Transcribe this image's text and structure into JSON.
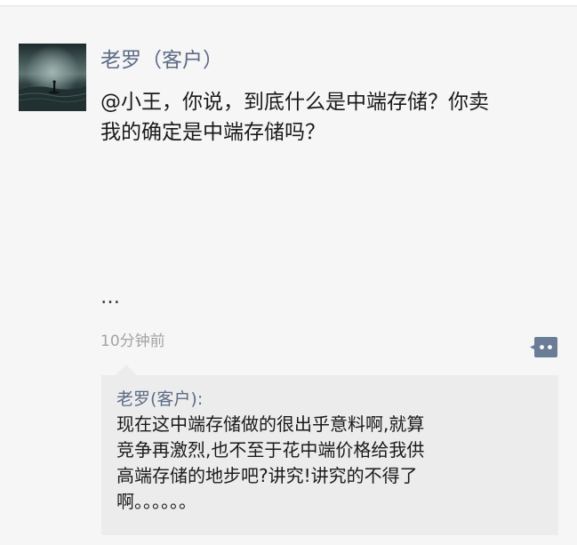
{
  "post": {
    "author": "老罗（客户）",
    "text_lines": [
      "@小王，你说，到底什么是中端存储？你卖",
      "我的确定是中端存储吗？"
    ],
    "ellipsis": "…",
    "timestamp": "10分钟前",
    "comment_icon": "comment-bubble-icon"
  },
  "comment": {
    "author": "老罗(客户):",
    "text_lines": [
      "现在这中端存储做的很出乎意料啊,就算",
      "竞争再激烈,也不至于花中端价格给我供",
      "高端存储的地步吧?讲究!讲究的不得了",
      "啊。。。。。。"
    ]
  },
  "colors": {
    "name": "#5c6b86",
    "text": "#1a1a1a",
    "time": "#a3a3a3",
    "comment_bg": "#ececec",
    "page_bg": "#f6f6f6"
  }
}
